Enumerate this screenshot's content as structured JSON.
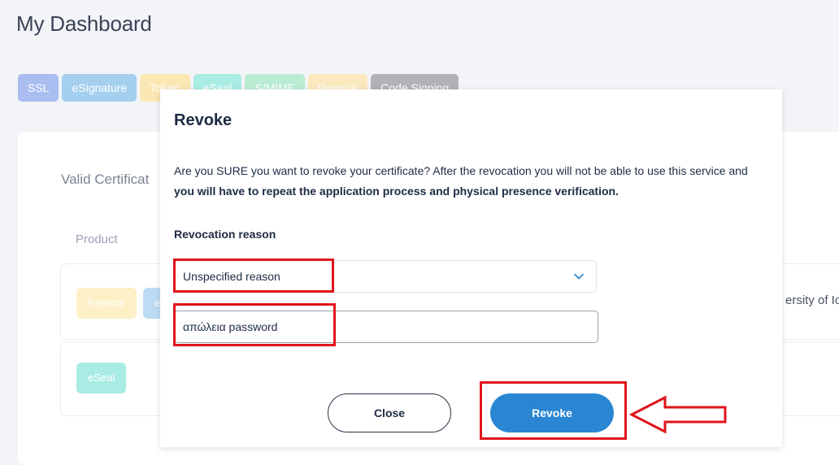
{
  "page": {
    "title": "My Dashboard"
  },
  "tabs": [
    {
      "label": "SSL",
      "color": "#a9bdf0"
    },
    {
      "label": "eSignature",
      "color": "#a5cfee"
    },
    {
      "label": "Token",
      "color": "#fbe7b4"
    },
    {
      "label": "eSeal",
      "color": "#a9ece3"
    },
    {
      "label": "S/MIME",
      "color": "#b9ecd2"
    },
    {
      "label": "Remote",
      "color": "#fbe9be"
    },
    {
      "label": "Code Signing",
      "color": "#b1b3b6"
    }
  ],
  "certificates": {
    "section_title": "Valid Certificat",
    "column_product": "Product",
    "rows": [
      {
        "badges": [
          {
            "label": "Remote",
            "color": "#fdf0c6"
          },
          {
            "label": "e",
            "color": "#bcdcf3"
          }
        ],
        "organization": "ersity of Io."
      },
      {
        "badges": [
          {
            "label": "eSeal",
            "color": "#a9ece3"
          }
        ]
      }
    ]
  },
  "modal": {
    "title": "Revoke",
    "message_plain": "Are you SURE you want to revoke your certificate? After the revocation you will not be able to use this service and ",
    "message_bold": "you will have to repeat the application process and physical presence verification.",
    "reason_label": "Revocation reason",
    "reason_select": {
      "selected": "Unspecified reason",
      "icon": "chevron-down-icon"
    },
    "reason_text": "απώλεια password",
    "close_label": "Close",
    "revoke_label": "Revoke",
    "revoke_color": "#2a86d3"
  },
  "annotation": {
    "color": "#e0141b",
    "arrow_icon": "left-arrow-icon"
  }
}
